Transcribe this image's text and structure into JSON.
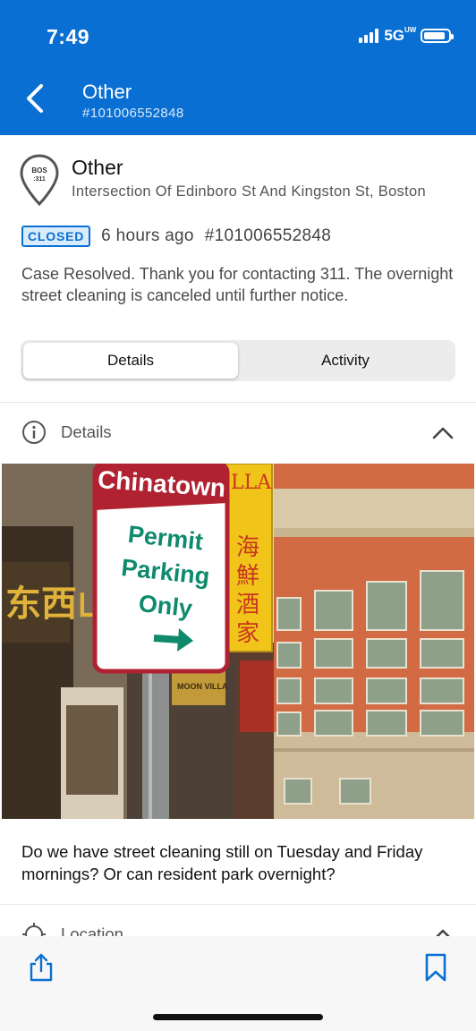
{
  "status_bar": {
    "time": "7:49",
    "network": "5G",
    "network_suffix": "UW",
    "battery_level": 0.9
  },
  "header": {
    "title": "Other",
    "subtitle": "#101006552848",
    "back_icon": "chevron-left-icon"
  },
  "case": {
    "icon_text_top": "BOS",
    "icon_text_bottom": ":311",
    "title": "Other",
    "address": "Intersection Of Edinboro St And Kingston St, Boston",
    "status": "CLOSED",
    "age": "6 hours ago",
    "number": "#101006552848",
    "resolution": "Case Resolved. Thank you for contacting 311. The overnight street cleaning is canceled until further notice."
  },
  "tabs": [
    {
      "label": "Details",
      "active": true
    },
    {
      "label": "Activity",
      "active": false
    }
  ],
  "details_section": {
    "label": "Details",
    "icon": "info-icon",
    "expanded": true
  },
  "photo": {
    "sign_top": "Chinatown",
    "sign_line1": "Permit",
    "sign_line2": "Parking",
    "sign_line3": "Only",
    "banner_top": "LLA",
    "banner_chars": [
      "海",
      "鮮",
      "酒",
      "家"
    ],
    "awning": "MOON VILLA"
  },
  "description": "Do we have street cleaning still on Tuesday and Friday mornings? Or can resident park overnight?",
  "location_section": {
    "label": "Location",
    "icon": "location-crosshair-icon"
  },
  "toolbar": {
    "share_icon": "share-icon",
    "bookmark_icon": "bookmark-icon"
  },
  "colors": {
    "brand": "#0a6fd2",
    "badge_bg": "#d9ecfb"
  }
}
